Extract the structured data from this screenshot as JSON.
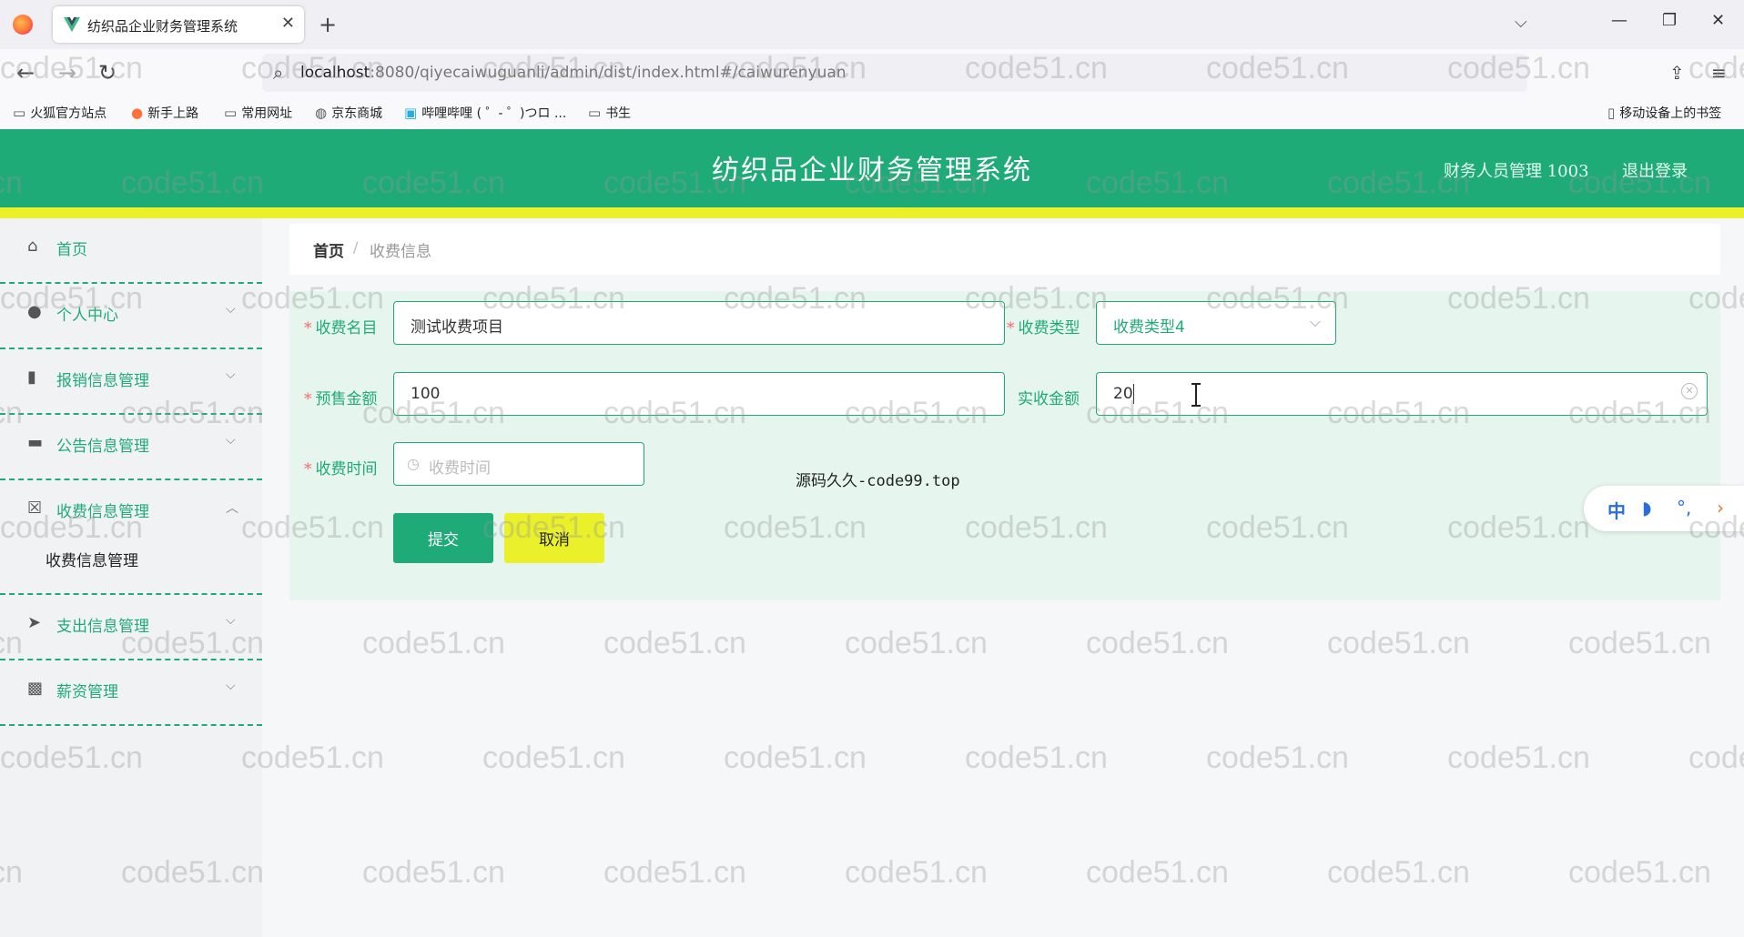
{
  "browser": {
    "tab_title": "纺织品企业财务管理系统",
    "url_host": "localhost",
    "url_path": ":8080/qiyecaiwuguanli/admin/dist/index.html#/caiwurenyuan",
    "bookmarks": [
      "火狐官方站点",
      "新手上路",
      "常用网址",
      "京东商城",
      "哔哩哔哩 ( ゜- ゜)つロ ...",
      "书生"
    ],
    "mobile_bookmarks": "移动设备上的书签"
  },
  "header": {
    "title": "纺织品企业财务管理系统",
    "user": "财务人员管理 1003",
    "logout": "退出登录"
  },
  "sidebar": {
    "items": [
      {
        "label": "首页",
        "icon": "home-icon"
      },
      {
        "label": "个人中心",
        "icon": "user-icon"
      },
      {
        "label": "报销信息管理",
        "icon": "report-icon"
      },
      {
        "label": "公告信息管理",
        "icon": "wallet-icon"
      },
      {
        "label": "收费信息管理",
        "icon": "cross-box-icon"
      },
      {
        "label": "支出信息管理",
        "icon": "send-icon"
      },
      {
        "label": "薪资管理",
        "icon": "ticket-icon"
      }
    ],
    "subitem": "收费信息管理"
  },
  "breadcrumb": {
    "home": "首页",
    "sep": "/",
    "current": "收费信息"
  },
  "form": {
    "name_label": "收费名目",
    "name_value": "测试收费项目",
    "type_label": "收费类型",
    "type_value": "收费类型4",
    "presale_label": "预售金额",
    "presale_value": "100",
    "actual_label": "实收金额",
    "actual_value": "20",
    "time_label": "收费时间",
    "time_placeholder": "收费时间",
    "submit": "提交",
    "cancel": "取消"
  },
  "promo": "源码久久-code99.top",
  "ime": {
    "lang": "中"
  },
  "watermark_text": "code51.cn",
  "colors": {
    "primary": "#1fab78",
    "accent": "#eaf12a",
    "danger": "#f56c6c"
  }
}
